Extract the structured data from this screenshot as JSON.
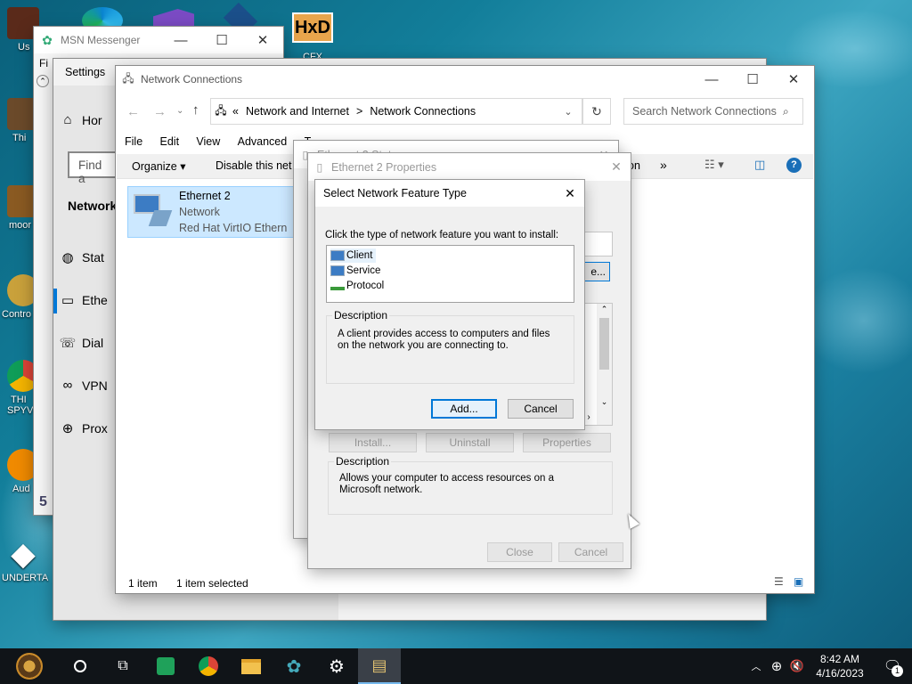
{
  "desktop": {
    "icons": [
      {
        "label": "Us"
      },
      {
        "label": "Thi"
      },
      {
        "label": "moor"
      },
      {
        "label": "Contro"
      },
      {
        "label": "THI"
      },
      {
        "label": "SPYV"
      },
      {
        "label": "Aud"
      },
      {
        "label": "UNDERTA"
      },
      {
        "label": "CFX"
      }
    ]
  },
  "msn": {
    "title": "MSN Messenger",
    "menu_fragment": "Fi"
  },
  "settings": {
    "title": "Settings",
    "home": "Hor",
    "search_placeholder": "Find a",
    "section": "Network",
    "items": [
      "Stat",
      "Ethe",
      "Dial",
      "VPN",
      "Prox"
    ]
  },
  "netconn": {
    "title": "Network Connections",
    "breadcrumb": [
      "«",
      "Network and Internet",
      ">",
      "Network Connections"
    ],
    "search_placeholder": "Search Network Connections",
    "menu": [
      "File",
      "Edit",
      "View",
      "Advanced",
      "T"
    ],
    "toolbar": {
      "organize": "Organize ▾",
      "disable": "Disable this net",
      "more_fragment": "on",
      "overflow": "»"
    },
    "item": {
      "name": "Ethernet 2",
      "type": "Network",
      "driver": "Red Hat VirtIO Ethern"
    },
    "status": {
      "count": "1 item",
      "selected": "1 item selected"
    }
  },
  "eth_status": {
    "title": "Ethernet 2 Status"
  },
  "eth_props": {
    "title": "Ethernet 2 Properties",
    "configure_fragment": "e...",
    "buttons": {
      "install": "Install...",
      "uninstall": "Uninstall",
      "properties": "Properties",
      "close": "Close",
      "cancel": "Cancel"
    },
    "description_label": "Description",
    "description": "Allows your computer to access resources on a Microsoft network."
  },
  "feature_dialog": {
    "title": "Select Network Feature Type",
    "prompt": "Click the type of network feature you want to install:",
    "options": [
      "Client",
      "Service",
      "Protocol"
    ],
    "selected_index": 0,
    "description_label": "Description",
    "description": "A client provides access to computers and files on the network you are connecting to.",
    "add": "Add...",
    "cancel": "Cancel"
  },
  "taskbar": {
    "time": "8:42 AM",
    "date": "4/16/2023",
    "notification_count": "1"
  }
}
